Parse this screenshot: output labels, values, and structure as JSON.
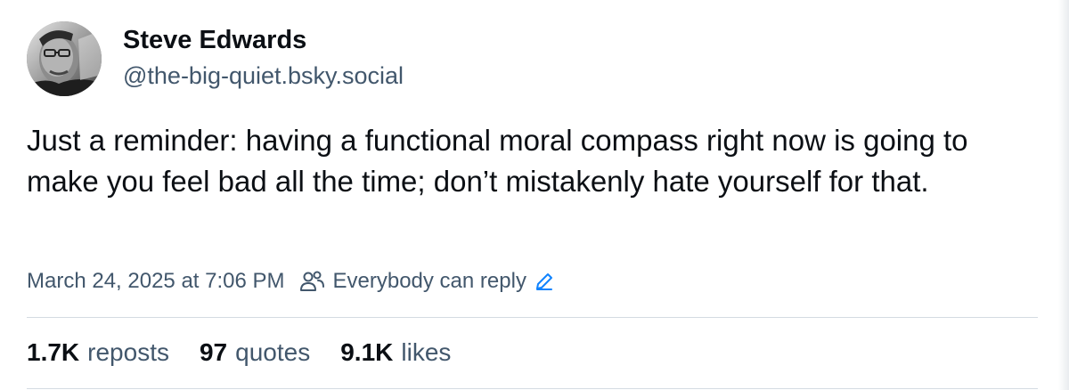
{
  "author": {
    "display_name": "Steve Edwards",
    "handle": "@the-big-quiet.bsky.social",
    "avatar": "profile-photo"
  },
  "post": {
    "text": "Just a reminder: having a functional moral compass right now is going to make you feel bad all the time; don’t mistakenly hate yourself for that."
  },
  "meta": {
    "timestamp": "March 24, 2025 at 7:06 PM",
    "reply_setting": "Everybody can reply",
    "reply_icon": "people-icon",
    "edit_icon": "pencil-icon"
  },
  "stats": [
    {
      "count": "1.7K",
      "label": "reposts"
    },
    {
      "count": "97",
      "label": "quotes"
    },
    {
      "count": "9.1K",
      "label": "likes"
    }
  ],
  "colors": {
    "text": "#0b0f14",
    "muted": "#42576c",
    "accent": "#1083fe",
    "divider": "#d4dbe2"
  }
}
